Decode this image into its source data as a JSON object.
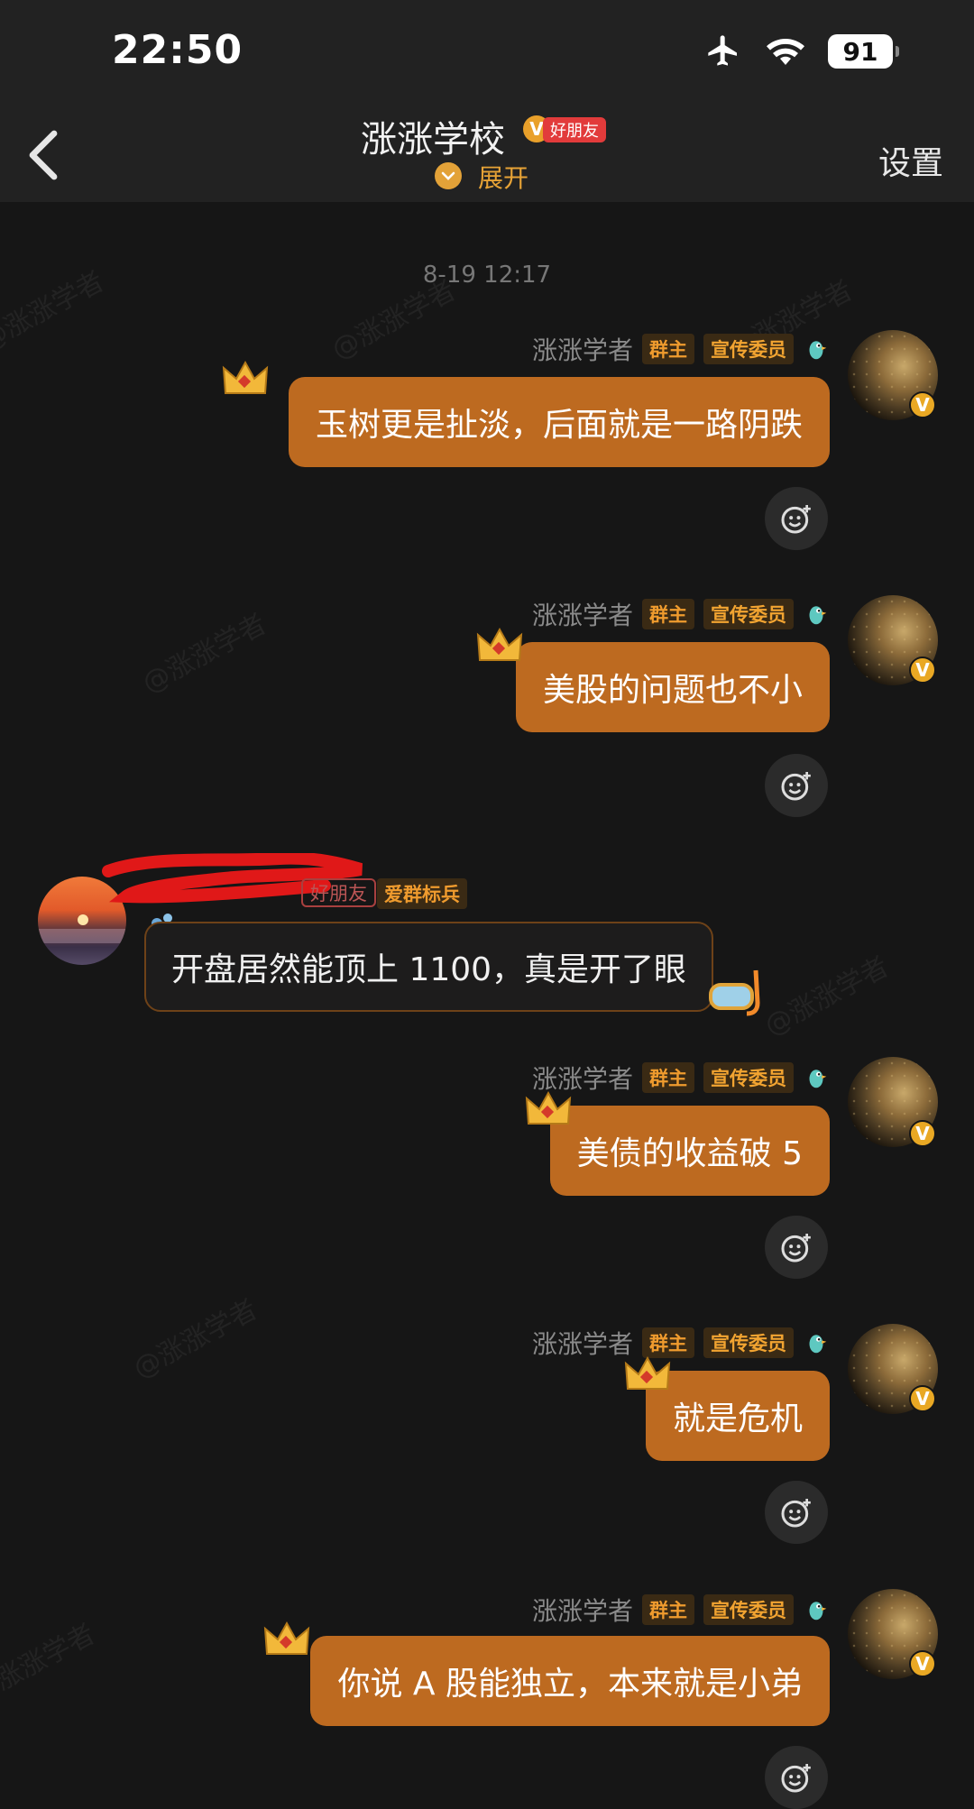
{
  "status_bar": {
    "time": "22:50",
    "battery": "91",
    "icons": [
      "airplane-icon",
      "wifi-icon"
    ]
  },
  "header": {
    "title": "涨涨学校",
    "badge": "好朋友",
    "badge_mark": "V",
    "expand_label": "展开",
    "settings_label": "设置"
  },
  "chat": {
    "timestamp": "8-19 12:17",
    "watermark": "@涨涨学者",
    "self_name": "涨涨学者",
    "tag_owner": "群主",
    "tag_role": "宣传委员",
    "verified_mark": "V",
    "messages": [
      {
        "text": "玉树更是扯淡，后面就是一路阴跌"
      },
      {
        "text": "美股的问题也不小"
      },
      {
        "text": "美债的收益破 5"
      },
      {
        "text": "就是危机"
      },
      {
        "text": "你说 A 股能独立，本来就是小弟"
      }
    ],
    "other": {
      "friend_tag": "好朋友",
      "tag": "爱群标兵",
      "text": "开盘居然能顶上 1100，真是开了眼"
    }
  },
  "colors": {
    "bubble_self": "#bd6a20",
    "bubble_other_border": "#6e4218",
    "accent": "#e7a336",
    "background": "#161616"
  }
}
